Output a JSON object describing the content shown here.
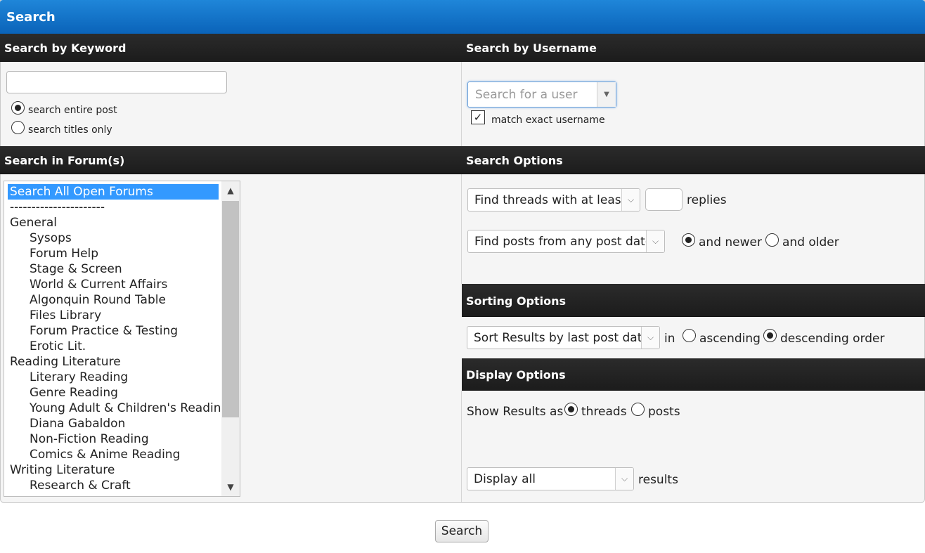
{
  "title": "Search",
  "keyword": {
    "heading": "Search by Keyword",
    "input_value": "",
    "options": [
      "search entire post",
      "search titles only"
    ],
    "selected": 0
  },
  "username": {
    "heading": "Search by Username",
    "placeholder": "Search for a user",
    "match_exact_label": "match exact username",
    "match_exact_checked": true
  },
  "forums": {
    "heading": "Search in Forum(s)",
    "items": [
      {
        "label": "Search All Open Forums",
        "indent": false,
        "selected": true
      },
      {
        "label": "----------------------",
        "indent": false
      },
      {
        "label": "General",
        "indent": false
      },
      {
        "label": "Sysops",
        "indent": true
      },
      {
        "label": "Forum Help",
        "indent": true
      },
      {
        "label": "Stage & Screen",
        "indent": true
      },
      {
        "label": "World & Current Affairs",
        "indent": true
      },
      {
        "label": "Algonquin Round Table",
        "indent": true
      },
      {
        "label": "Files Library",
        "indent": true
      },
      {
        "label": "Forum Practice & Testing",
        "indent": true
      },
      {
        "label": "Erotic Lit.",
        "indent": true
      },
      {
        "label": "Reading Literature",
        "indent": false
      },
      {
        "label": "Literary Reading",
        "indent": true
      },
      {
        "label": "Genre Reading",
        "indent": true
      },
      {
        "label": "Young Adult & Children's Reading",
        "indent": true
      },
      {
        "label": "Diana Gabaldon",
        "indent": true
      },
      {
        "label": "Non-Fiction Reading",
        "indent": true
      },
      {
        "label": "Comics & Anime Reading",
        "indent": true
      },
      {
        "label": "Writing Literature",
        "indent": false
      },
      {
        "label": "Research & Craft",
        "indent": true
      }
    ]
  },
  "search_options": {
    "heading": "Search Options",
    "threads_select": "Find threads with at least",
    "replies_value": "",
    "replies_label": "replies",
    "date_select": "Find posts from any post date",
    "newer_label": "and newer",
    "older_label": "and older",
    "date_direction": "newer"
  },
  "sorting": {
    "heading": "Sorting Options",
    "sort_select": "Sort Results by last post date",
    "in_label": "in",
    "ascending_label": "ascending",
    "descending_label": "descending order",
    "order": "descending"
  },
  "display": {
    "heading": "Display Options",
    "show_label": "Show Results as",
    "threads_label": "threads",
    "posts_label": "posts",
    "show_as": "threads",
    "display_select": "Display all",
    "results_label": "results"
  },
  "submit_label": "Search"
}
